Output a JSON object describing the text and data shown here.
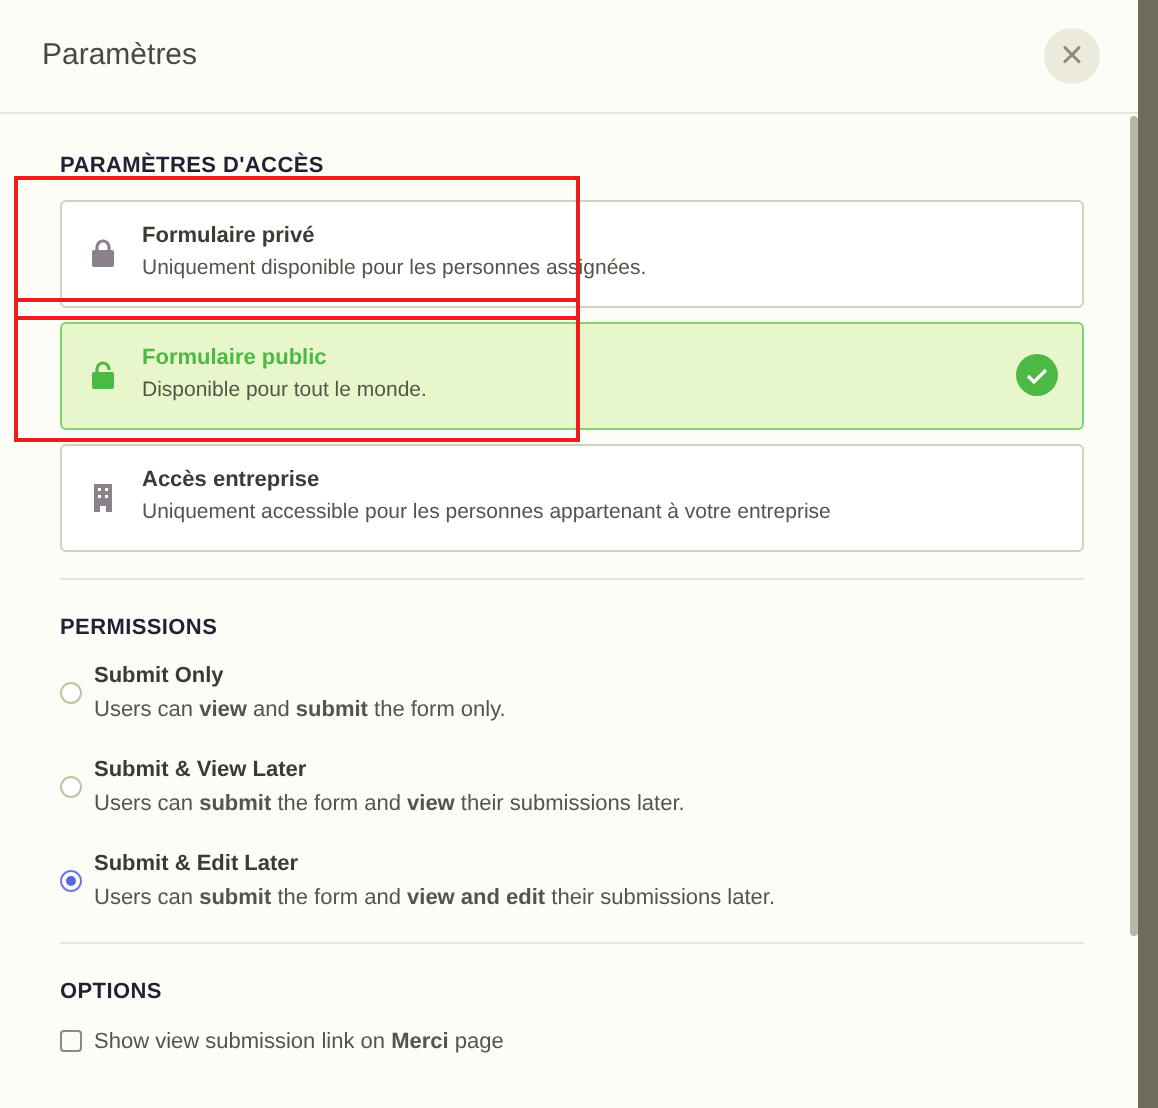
{
  "dialog": {
    "title": "Paramètres",
    "close": "×"
  },
  "access": {
    "heading": "PARAMÈTRES D'ACCÈS",
    "options": [
      {
        "kind": "lock",
        "title": "Formulaire privé",
        "description": "Uniquement disponible pour les personnes assignées.",
        "selected": false,
        "highlighted": true
      },
      {
        "kind": "unlock",
        "title": "Formulaire public",
        "description": "Disponible pour tout le monde.",
        "selected": true,
        "highlighted": true
      },
      {
        "kind": "building",
        "title": "Accès entreprise",
        "description": "Uniquement accessible pour les personnes appartenant à votre entreprise",
        "selected": false,
        "highlighted": false
      }
    ]
  },
  "permissions": {
    "heading": "PERMISSIONS",
    "options": [
      {
        "title": "Submit Only",
        "description": "Users can **view** and **submit** the form only.",
        "selected": false
      },
      {
        "title": "Submit & View Later",
        "description": "Users can **submit** the form and **view** their submissions later.",
        "selected": false
      },
      {
        "title": "Submit & Edit Later",
        "description": "Users can **submit** the form and **view and edit** their submissions later.",
        "selected": true
      }
    ]
  },
  "options": {
    "heading": "OPTIONS",
    "items": [
      {
        "label": "Show view submission link on **Merci** page",
        "checked": false
      }
    ]
  }
}
